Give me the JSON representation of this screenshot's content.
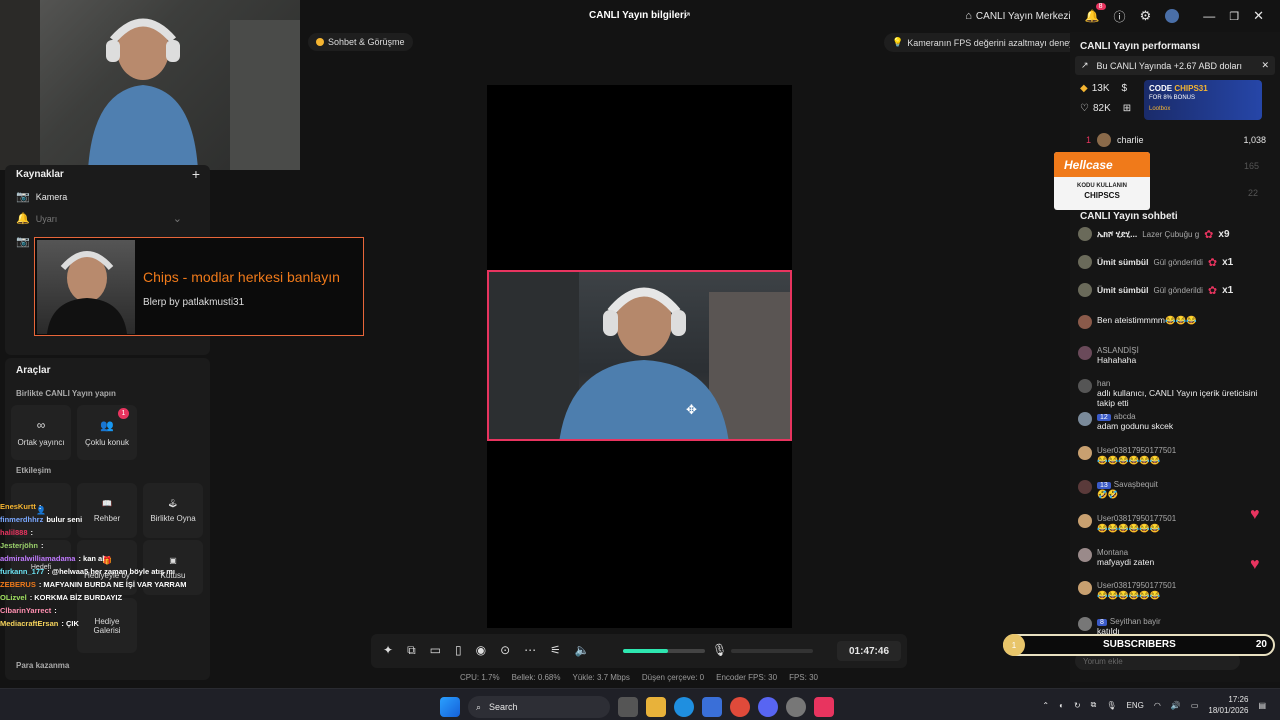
{
  "titlebar": {
    "title": "CANLI Yayın bilgileri",
    "studio_label": "CANLI Yayın Merkezi",
    "notif_count": "8"
  },
  "pills": {
    "chat_call": "Sohbet & Görüşme",
    "fps_tip": "Kameranın FPS değerini azaltmayı deneyin"
  },
  "sources": {
    "title": "Kaynaklar",
    "items": [
      {
        "label": "Kamera"
      },
      {
        "label": "Uyarı"
      },
      {
        "label": "I"
      }
    ]
  },
  "overlay": {
    "title": "Chips - modlar herkesi banlayın",
    "subtitle": "Blerp by patlakmusti31"
  },
  "tools": {
    "title": "Araçlar",
    "collab_title": "Birlikte CANLI Yayın yapın",
    "cohost": "Ortak yayıncı",
    "multiguest": "Çoklu konuk",
    "multiguest_badge": "1",
    "interaction_title": "Etkileşim",
    "guide": "Rehber",
    "play_together": "Birlikte Oyna",
    "gift_goal": "Hediyeyle oy",
    "gift_box": "Kutusu",
    "gift_gallery_1": "Hediye",
    "gift_gallery_2": "Galerisi",
    "earn": "Para kazanma"
  },
  "stream_chat": [
    {
      "name": "EnesKurtt",
      "text": ":"
    },
    {
      "name": "finmerdhhrz",
      "text": "bulur seni"
    },
    {
      "name": "halil888",
      "text": ":"
    },
    {
      "name": "Jesterjöhn",
      "text": ":"
    },
    {
      "name": "admiralwilliamadama",
      "text": ": kan al"
    },
    {
      "name": "furkann_177",
      "text": ": @helwaa5 her zaman böyle atış mı"
    },
    {
      "name": "ZEBERUS",
      "text": ": MAFYANIN BURDA NE İŞİ VAR YARRAM"
    },
    {
      "name": "OLizvel",
      "text": ": KORKMA BİZ BURDAYIZ"
    },
    {
      "name": "ClbarinYarrect",
      "text": ":"
    },
    {
      "name": "MediacraftErsan",
      "text": ": ÇIK"
    }
  ],
  "controls": {
    "timer": "01:47:46",
    "volume_level": 0.55
  },
  "stats": {
    "cpu": "CPU: 1.7%",
    "memory": "Bellek: 0.68%",
    "upload": "Yükle: 3.7 Mbps",
    "dropped": "Düşen çerçeve: 0",
    "encoder": "Encoder FPS: 30",
    "fps": "FPS: 30"
  },
  "right": {
    "perf_title": "CANLI Yayın performansı",
    "banner": "Bu CANLI Yayında +2.67 ABD doları",
    "stat1": "13K",
    "stat2": "82K",
    "ad_code": "CODE",
    "ad_code_value": "CHIPS31",
    "ad_bonus": "FOR 8% BONUS",
    "ad_brand": "Lootbox",
    "rank1_pos": "1",
    "rank1_name": "charlie",
    "rank1_score": "1,038",
    "rank2_score": "165",
    "rank3_score": "22",
    "hellcase_brand": "Hellcase",
    "hellcase_line1": "KODU KULLANIN",
    "hellcase_line2": "CHIPSCS",
    "chat_title": "CANLI Yayın sohbeti",
    "gift_rows": [
      {
        "name": "ኤክሾ ሂደሂ...",
        "text": "Lazer Çubuğu g",
        "count": "x9"
      },
      {
        "name": "Ümit sümbül",
        "text": "Gül gönderildi",
        "count": "x1"
      },
      {
        "name": "Ümit sümbül",
        "text": "Gül gönderildi",
        "count": "x1"
      }
    ],
    "messages": [
      {
        "name": "",
        "text": "Ben ateistimmmm😂😂😂"
      },
      {
        "name": "ASLANDİŞİ",
        "text": "Hahahaha"
      },
      {
        "name": "han",
        "text": "adlı kullanıcı, CANLI Yayın içerik üreticisini takip etti"
      },
      {
        "name": "abcda",
        "level": "12",
        "text": "adam godunu skcek"
      },
      {
        "name": "User03817950177501",
        "text": "😂😂😂😂😂😂"
      },
      {
        "name": "Savaşbequit",
        "level": "13",
        "text": "🤣🤣"
      },
      {
        "name": "User03817950177501",
        "text": "😂😂😂😂😂😂"
      },
      {
        "name": "Montana",
        "text": "mafyaydi zaten"
      },
      {
        "name": "User03817950177501",
        "text": "😂😂😂😂😂😂"
      },
      {
        "name": "Seyithan bayir",
        "level": "8",
        "text": "katıldı"
      }
    ],
    "comment_placeholder": "Yorum ekle"
  },
  "subs": {
    "left": "1",
    "label": "SUBSCRIBERS",
    "count": "20"
  },
  "taskbar": {
    "search": "Search",
    "lang": "ENG",
    "time": "17:26",
    "date": "18/01/2026"
  },
  "colors": {
    "accent": "#e8345f",
    "gold": "#f5b531",
    "hellcase": "#f07a1a"
  }
}
